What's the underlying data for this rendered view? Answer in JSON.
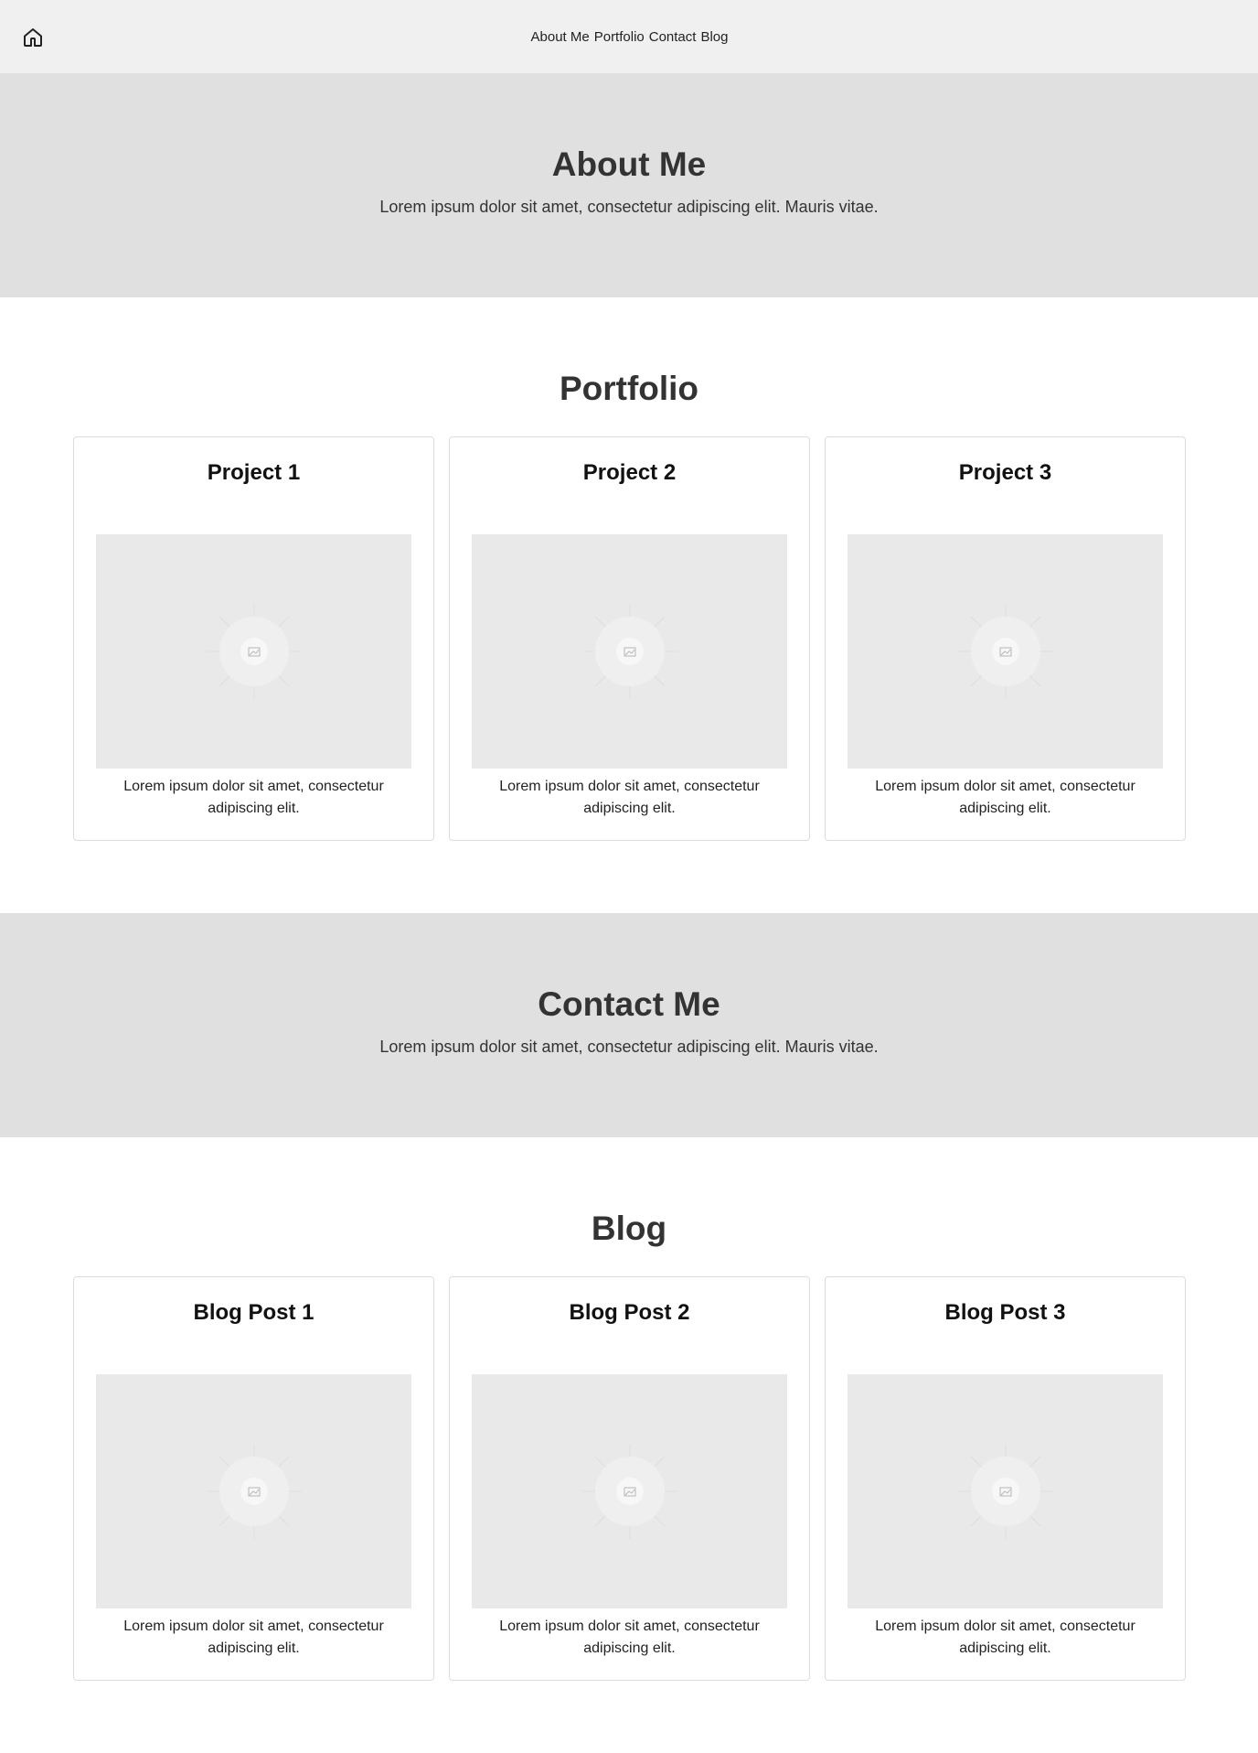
{
  "nav": {
    "home_icon": "home-icon",
    "links": [
      "About Me",
      "Portfolio",
      "Contact",
      "Blog"
    ]
  },
  "about": {
    "title": "About Me",
    "text": "Lorem ipsum dolor sit amet, consectetur adipiscing elit. Mauris vitae."
  },
  "portfolio": {
    "title": "Portfolio",
    "cards": [
      {
        "title": "Project 1",
        "text": "Lorem ipsum dolor sit amet, consectetur adipiscing elit."
      },
      {
        "title": "Project 2",
        "text": "Lorem ipsum dolor sit amet, consectetur adipiscing elit."
      },
      {
        "title": "Project 3",
        "text": "Lorem ipsum dolor sit amet, consectetur adipiscing elit."
      }
    ]
  },
  "contact": {
    "title": "Contact Me",
    "text": "Lorem ipsum dolor sit amet, consectetur adipiscing elit. Mauris vitae."
  },
  "blog": {
    "title": "Blog",
    "cards": [
      {
        "title": "Blog Post 1",
        "text": "Lorem ipsum dolor sit amet, consectetur adipiscing elit."
      },
      {
        "title": "Blog Post 2",
        "text": "Lorem ipsum dolor sit amet, consectetur adipiscing elit."
      },
      {
        "title": "Blog Post 3",
        "text": "Lorem ipsum dolor sit amet, consectetur adipiscing elit."
      }
    ]
  },
  "colors": {
    "nav_bg": "#f0f0f0",
    "band_bg": "#e0e0e0",
    "placeholder_bg": "#e9e9e9",
    "heading": "#333333"
  },
  "icons": {
    "placeholder": "image-placeholder-icon"
  }
}
